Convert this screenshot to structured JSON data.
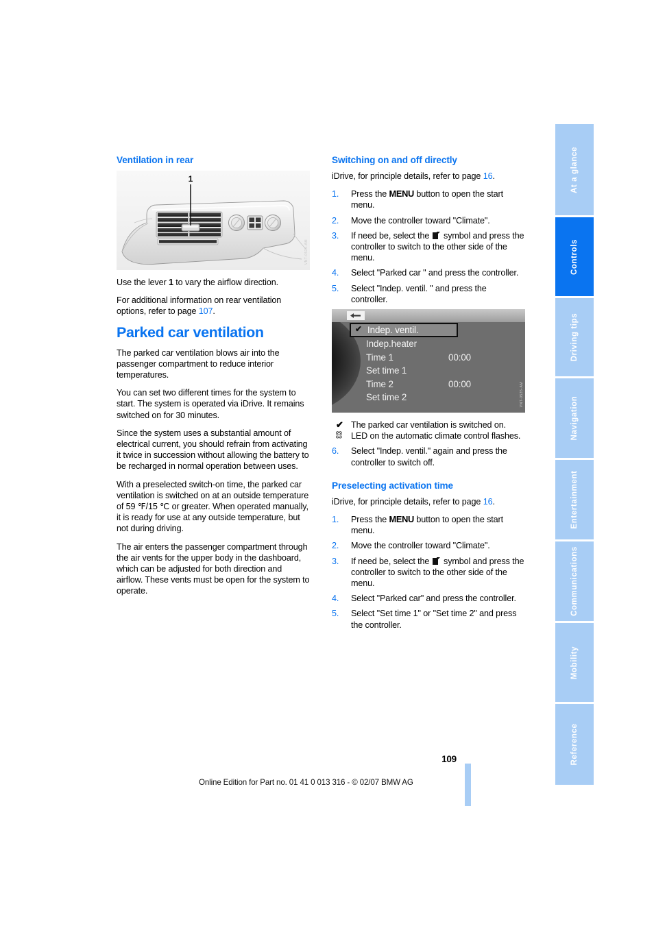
{
  "document": {
    "page_number": "109",
    "footer_note": "Online Edition for Part no. 01 41 0 013 316 - © 02/07 BMW AG"
  },
  "section_tabs": [
    {
      "label": "At a glance",
      "active": false
    },
    {
      "label": "Controls",
      "active": true
    },
    {
      "label": "Driving tips",
      "active": false
    },
    {
      "label": "Navigation",
      "active": false
    },
    {
      "label": "Entertainment",
      "active": false
    },
    {
      "label": "Communications",
      "active": false
    },
    {
      "label": "Mobility",
      "active": false
    },
    {
      "label": "Reference",
      "active": false
    }
  ],
  "colors": {
    "accent_blue": "#0a74f0",
    "tab_inactive": "#a8cdf5",
    "tab_active": "#0a74f0"
  },
  "left_column": {
    "subheading": "Ventilation in rear",
    "figure": {
      "name": "rear-ventilation-vent",
      "callout": "1",
      "credit": "VNT-0535-AM"
    },
    "paragraphs": [
      {
        "id": "p1",
        "parts": [
          {
            "t": "Use the lever "
          },
          {
            "t": "1",
            "style": "bold"
          },
          {
            "t": " to vary the airflow direction."
          }
        ]
      },
      {
        "id": "p2",
        "parts": [
          {
            "t": "For additional information on rear ventilation options, refer to page "
          },
          {
            "t": "107",
            "style": "pageref"
          },
          {
            "t": "."
          }
        ]
      }
    ],
    "heading": "Parked car ventilation",
    "body_paragraphs": [
      "The parked car ventilation blows air into the passenger compartment to reduce interior temperatures.",
      "You can set two different times for the system to start. The system is operated via iDrive. It remains switched on for 30 minutes.",
      "Since the system uses a substantial amount of electrical current, you should refrain from activating it twice in succession without allowing the battery to be recharged in normal operation between uses.",
      "With a preselected switch-on time, the parked car ventilation is switched on at an outside temperature of 59 ℉/15 ℃ or greater. When operated manually, it is ready for use at any outside temperature, but not during driving.",
      "The air enters the passenger compartment through the air vents for the upper body in the dashboard, which can be adjusted for both direction and airflow. These vents must be open for the system to operate."
    ]
  },
  "right_column": {
    "section1": {
      "subheading": "Switching on and off directly",
      "intro_pre": "iDrive, for principle details, refer to page ",
      "intro_page": "16",
      "intro_post": ".",
      "steps": [
        {
          "num": "1.",
          "pre": "Press the ",
          "menu": "MENU",
          "post": " button to open the start menu."
        },
        {
          "num": "2.",
          "text": "Move the controller toward \"Climate\"."
        },
        {
          "num": "3.",
          "pre": "If need be, select the ",
          "symbol": "switch-side-symbol",
          "post": " symbol and press the controller to switch to the other side of the menu."
        },
        {
          "num": "4.",
          "text": "Select \"Parked car \" and press the controller."
        },
        {
          "num": "5.",
          "text": "Select \"Indep. ventil. \" and press the controller."
        }
      ]
    },
    "idrive_figure": {
      "name": "idrive-parked-car-menu",
      "credit": "VNT-0535-AM",
      "back_icon": "back-arrow-icon",
      "rows": [
        {
          "label": "Indep. ventil.",
          "value": "",
          "checked": true,
          "selected": true
        },
        {
          "label": "Indep.heater",
          "value": "",
          "checked": false,
          "selected": false
        },
        {
          "label": "Time 1",
          "value": "00:00",
          "checked": false,
          "selected": false
        },
        {
          "label": "Set time 1",
          "value": "",
          "checked": false,
          "selected": false
        },
        {
          "label": "Time 2",
          "value": "00:00",
          "checked": false,
          "selected": false
        },
        {
          "label": "Set time 2",
          "value": "",
          "checked": false,
          "selected": false
        }
      ]
    },
    "result_notes": [
      {
        "glyph": "check",
        "text": "The parked car ventilation is switched on."
      },
      {
        "glyph": "led",
        "text": "LED on the automatic climate control flashes."
      }
    ],
    "step6": {
      "num": "6.",
      "text": "Select \"Indep. ventil.\" again and press the controller to switch off."
    },
    "section2": {
      "subheading": "Preselecting activation time",
      "intro_pre": "iDrive, for principle details, refer to page ",
      "intro_page": "16",
      "intro_post": ".",
      "steps": [
        {
          "num": "1.",
          "pre": "Press the ",
          "menu": "MENU",
          "post": " button to open the start menu."
        },
        {
          "num": "2.",
          "text": "Move the controller toward \"Climate\"."
        },
        {
          "num": "3.",
          "pre": "If need be, select the ",
          "symbol": "switch-side-symbol",
          "post": " symbol and press the controller to switch to the other side of the menu."
        },
        {
          "num": "4.",
          "text": "Select \"Parked car\" and press the controller."
        },
        {
          "num": "5.",
          "text": "Select \"Set time 1\" or \"Set time 2\" and press the controller."
        }
      ]
    }
  }
}
